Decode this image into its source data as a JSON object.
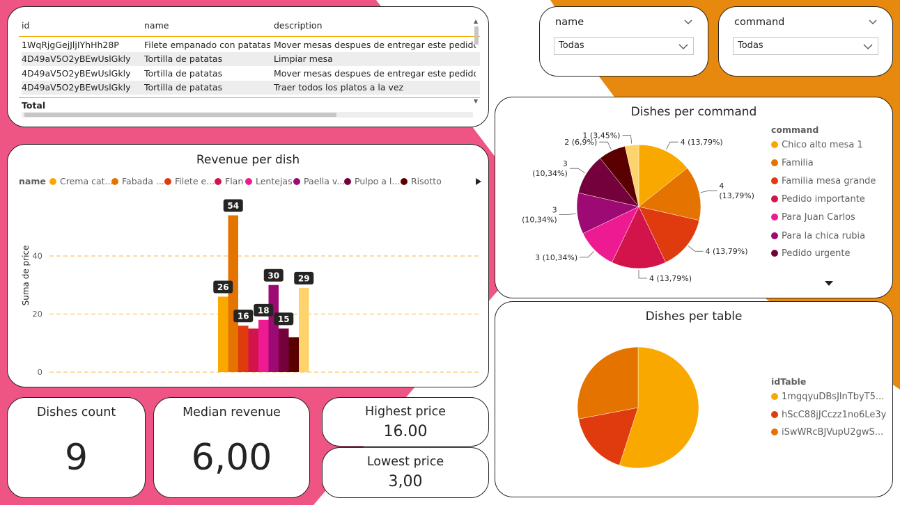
{
  "colors": {
    "pink": "#EE5584",
    "orange": "#E8890F",
    "series": [
      "#F9A800",
      "#E57300",
      "#DF3B0E",
      "#D3144A",
      "#EE1A91",
      "#9E0A73",
      "#74003C",
      "#5A0000",
      "#FFD36B"
    ]
  },
  "table": {
    "headers": [
      "id",
      "name",
      "description"
    ],
    "rows": [
      [
        "1WqRjgGejJljIYhHh28P",
        "Filete empanado con patatas",
        "Mover mesas despues de entregar este pedido"
      ],
      [
        "4D49aV5O2yBEwUslGkly",
        "Tortilla de patatas",
        "Limpiar mesa"
      ],
      [
        "4D49aV5O2yBEwUslGkly",
        "Tortilla de patatas",
        "Mover mesas despues de entregar este pedido"
      ],
      [
        "4D49aV5O2yBEwUslGkly",
        "Tortilla de patatas",
        "Traer todos los platos a la vez"
      ]
    ],
    "total_label": "Total"
  },
  "slicers": [
    {
      "label": "name",
      "value": "Todas"
    },
    {
      "label": "command",
      "value": "Todas"
    }
  ],
  "revenue": {
    "title": "Revenue per dish",
    "legend_title": "name",
    "legend_items": [
      "Crema cat...",
      "Fabada ...",
      "Filete e...",
      "Flan",
      "Lentejas",
      "Paella v...",
      "Pulpo a l...",
      "Risotto"
    ],
    "ylabel": "Suma de price",
    "yticks": [
      "0",
      "20",
      "40"
    ]
  },
  "pie_command": {
    "title": "Dishes per command",
    "legend_title": "command",
    "legend_items": [
      "Chico alto mesa 1",
      "Familia",
      "Familia mesa grande",
      "Pedido importante",
      "Para Juan Carlos",
      "Para la chica rubia",
      "Pedido urgente"
    ],
    "slice_labels": [
      "4 (13,79%)",
      "4\n(13,79%)",
      "4 (13,79%)",
      "4 (13,79%)",
      "3 (10,34%)",
      "3\n(10,34%)",
      "3\n(10,34%)",
      "2 (6,9%)",
      "1 (3,45%)"
    ]
  },
  "pie_table": {
    "title": "Dishes per table",
    "legend_title": "idTable",
    "legend_items": [
      "1mgqyuDBsJlnTbyT5...",
      "hScC88jJCczz1no6Le3y",
      "iSwWRcBJVupU2gwS..."
    ]
  },
  "kpis": {
    "dishes_count": {
      "label": "Dishes count",
      "value": "9"
    },
    "median_revenue": {
      "label": "Median revenue",
      "value": "6,00"
    },
    "highest_price": {
      "label": "Highest price",
      "value": "16.00"
    },
    "lowest_price": {
      "label": "Lowest price",
      "value": "3,00"
    }
  },
  "chart_data": [
    {
      "type": "bar",
      "title": "Revenue per dish",
      "ylabel": "Suma de price",
      "xlabel": "",
      "ylim": [
        0,
        58
      ],
      "categories": [
        "Crema catalana",
        "Fabada",
        "Filete empanado",
        "Flan",
        "Lentejas",
        "Paella",
        "Pulpo",
        "Risotto",
        "Tortilla de patatas"
      ],
      "values": [
        26,
        54,
        16,
        15,
        18,
        30,
        15,
        12,
        29
      ],
      "data_labels": [
        "26",
        "54",
        "16",
        "",
        "18",
        "30",
        "15",
        "",
        "29"
      ]
    },
    {
      "type": "pie",
      "title": "Dishes per command",
      "values": [
        4,
        4,
        4,
        4,
        3,
        3,
        3,
        2,
        1
      ],
      "labels": [
        "4 (13,79%)",
        "4 (13,79%)",
        "4 (13,79%)",
        "4 (13,79%)",
        "3 (10,34%)",
        "3 (10,34%)",
        "3 (10,34%)",
        "2 (6,9%)",
        "1 (3,45%)"
      ]
    },
    {
      "type": "pie",
      "title": "Dishes per table",
      "categories": [
        "1mgqyuDBsJlnTbyT5...",
        "hScC88jJCczz1no6Le3y",
        "iSwWRcBJVupU2gwS..."
      ],
      "values": [
        0.55,
        0.17,
        0.28
      ]
    }
  ]
}
